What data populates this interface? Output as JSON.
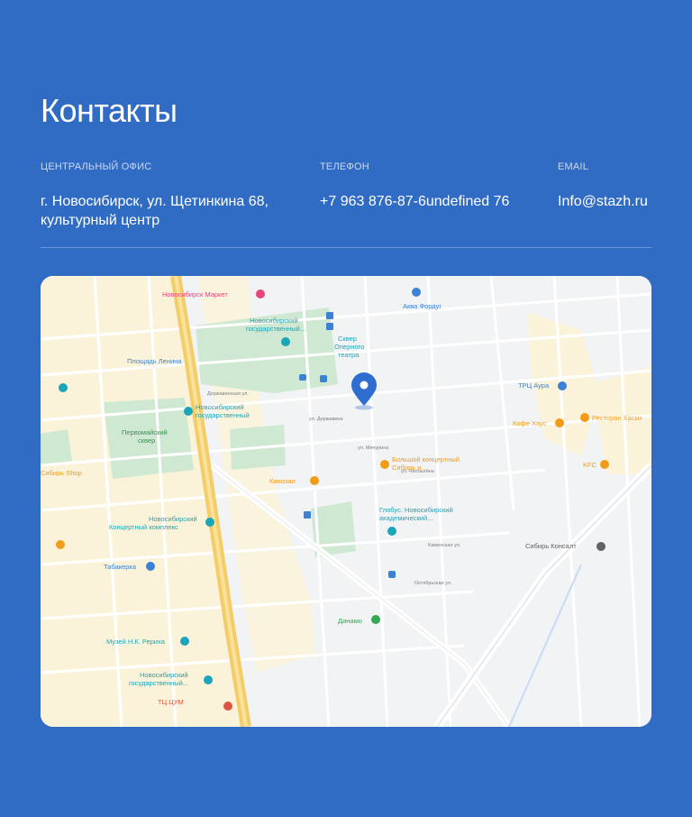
{
  "contacts": {
    "title": "Контакты",
    "office": {
      "label": "Центральный офис",
      "value": "г. Новосибирск, ул. Щетинкина 68, культурный центр"
    },
    "phone": {
      "label": "Телефон",
      "value": "+7 963 876-87-6undefined 76"
    },
    "email": {
      "label": "Email",
      "value": "Info@stazh.ru"
    }
  },
  "map": {
    "pin_icon": "map-pin-icon",
    "pois": [
      {
        "name": "Новосибирск Маркет",
        "color": "#e8457a"
      },
      {
        "name": "Новосибирский государственный...",
        "color": "#1aa6b8"
      },
      {
        "name": "Сквер Оперного театра",
        "color": "#1aa6b8"
      },
      {
        "name": "Аква Фордуг",
        "color": "#3b82d6"
      },
      {
        "name": "Площадь Ленина",
        "color": "#3b82d6"
      },
      {
        "name": "Новосибирский государственный",
        "color": "#1aa6b8"
      },
      {
        "name": "Первомайский сквер",
        "color": "#3a8f53"
      },
      {
        "name": "ТРЦ Аура",
        "color": "#3b82d6"
      },
      {
        "name": "Кофе Хаус",
        "color": "#f29b18"
      },
      {
        "name": "Ресторан Хаски",
        "color": "#f29b18"
      },
      {
        "name": "Сибирь Shop",
        "color": "#f29b18"
      },
      {
        "name": "Кинозал",
        "color": "#f29b18"
      },
      {
        "name": "Большой концертный Сибирь и ...",
        "color": "#f29b18"
      },
      {
        "name": "KFC",
        "color": "#f29b18"
      },
      {
        "name": "Новосибирский Концертный комплекс",
        "color": "#1aa6b8"
      },
      {
        "name": "Глобус. Новосибирский академический...",
        "color": "#1aa6b8"
      },
      {
        "name": "Сибирь Консалт",
        "color": "#5f6368"
      },
      {
        "name": "Табакерка",
        "color": "#3b82d6"
      },
      {
        "name": "Динамо",
        "color": "#34a853"
      },
      {
        "name": "Музей Н.К. Рериха",
        "color": "#1aa6b8"
      },
      {
        "name": "Новосибирский государственный...",
        "color": "#1aa6b8"
      },
      {
        "name": "ТЦ ЦУМ",
        "color": "#e0533e"
      }
    ]
  }
}
